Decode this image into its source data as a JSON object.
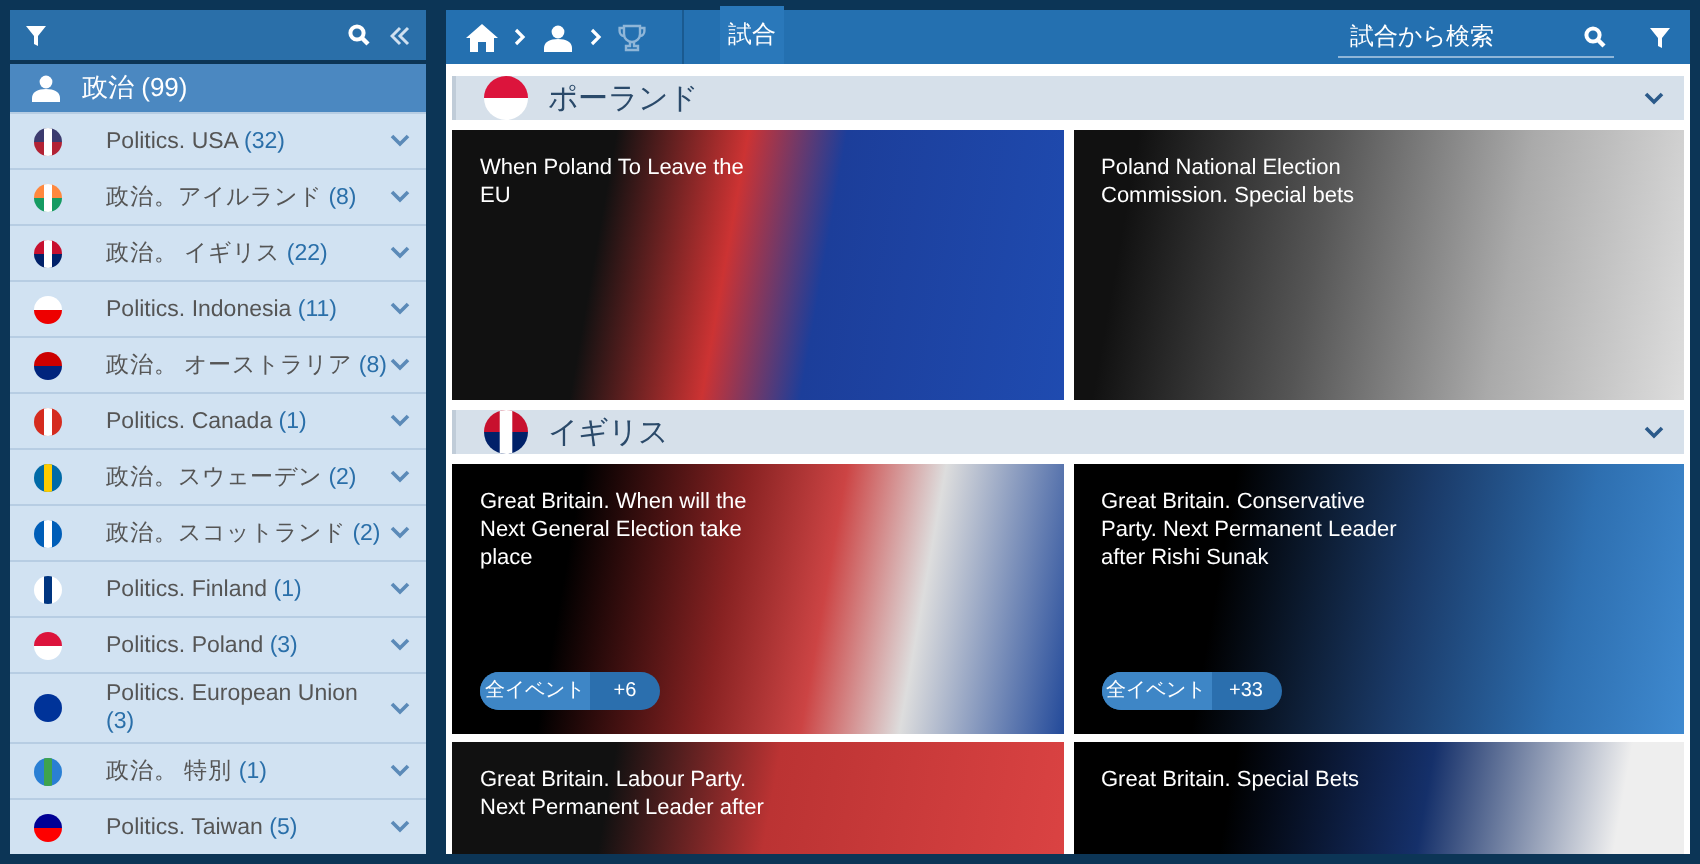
{
  "sidebar": {
    "category": {
      "label": "政治",
      "count": "(99)",
      "selected": true
    },
    "items": [
      {
        "label": "Politics. USA",
        "count": "(32)",
        "selected": false
      },
      {
        "label": "政治。アイルランド",
        "count": "(8)",
        "selected": false
      },
      {
        "label": "政治。 イギリス",
        "count": "(22)",
        "selected": false
      },
      {
        "label": "Politics. Indonesia",
        "count": "(11)",
        "selected": false
      },
      {
        "label": "政治。 オーストラリア",
        "count": "(8)",
        "selected": false
      },
      {
        "label": "Politics. Canada",
        "count": "(1)",
        "selected": false
      },
      {
        "label": "政治。スウェーデン",
        "count": "(2)",
        "selected": false
      },
      {
        "label": "政治。スコットランド",
        "count": "(2)",
        "selected": false
      },
      {
        "label": "Politics. Finland",
        "count": "(1)",
        "selected": false
      },
      {
        "label": "Politics. Poland",
        "count": "(3)",
        "selected": false
      },
      {
        "label": "Politics. European Union",
        "count": "(3)",
        "selected": false
      },
      {
        "label": "政治。 特別",
        "count": "(1)",
        "selected": false
      },
      {
        "label": "Politics. Taiwan",
        "count": "(5)",
        "selected": false
      }
    ]
  },
  "topbar": {
    "tabs": [
      {
        "label": "試合",
        "selected": true
      }
    ],
    "search": {
      "placeholder": "試合から検索"
    }
  },
  "sections": [
    {
      "title": "ポーランド",
      "cards": [
        {
          "title": "When Poland To Leave the EU"
        },
        {
          "title": "Poland National Election Commission. Special bets"
        }
      ]
    },
    {
      "title": "イギリス",
      "cards": [
        {
          "title": "Great Britain. When will the Next General Election take place",
          "button": "全イベント",
          "count": "+6"
        },
        {
          "title": "Great Britain. Conservative Party. Next Permanent Leader after Rishi Sunak",
          "button": "全イベント",
          "count": "+33"
        },
        {
          "title": "Great Britain. Labour Party. Next Permanent Leader after"
        },
        {
          "title": "Great Britain. Special Bets"
        }
      ]
    }
  ]
}
